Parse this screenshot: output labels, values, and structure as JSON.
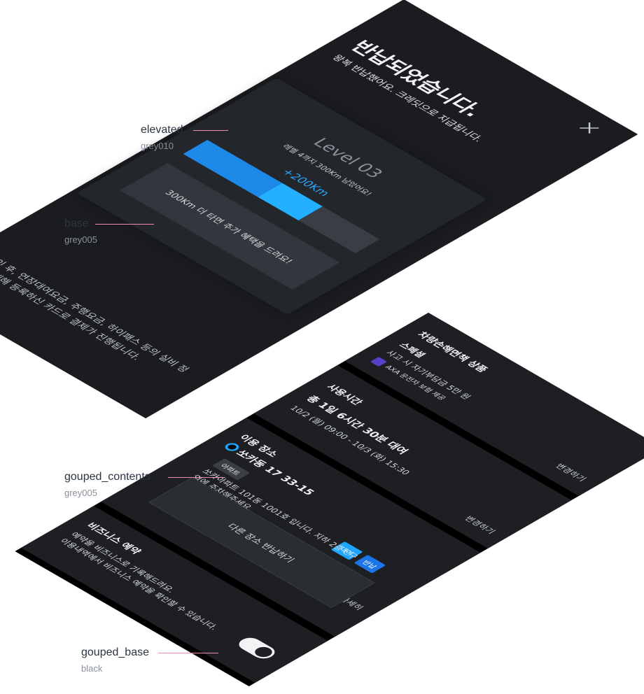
{
  "complete_screen": {
    "title": "반납되었습니다.",
    "subtitle": "왕복 반납했어요. 크레딧으로 지급됩니다.",
    "notice": "확인 후, 연장대여요금, 주행요금, 하이패스 등의 실비 정산에 대해 등록하신 카드로 결제가 진행됩니다."
  },
  "level_card": {
    "title": "Level 03",
    "subtitle": "레벨 4까지 300Km 남았어요!",
    "gain": "+200Km",
    "progress": 0.67,
    "button": "300Km 더 타면 추가 혜택을 드려요!"
  },
  "insurance": {
    "title": "차량손해면책 상품",
    "plan": "스페셜",
    "desc": "사고 시 자기부담금 5만 원",
    "badge": "AXA 운전자 보험 제공",
    "change": "변경하기"
  },
  "usage_time": {
    "title": "사용시간",
    "total": "총 1일 6시간 30분 대여",
    "range": "10/2 (월) 09:00 - 10/3 (화) 15:30",
    "change": "변경하기"
  },
  "place": {
    "title": "이용 장소",
    "name": "쏘카동 17 33-15",
    "chip": "아파트",
    "rent_chip": "대여",
    "return_chip": "반납",
    "desc": "쏘카아파트 101동 1001호 입니다. 지하 2층 C구역에 주차해주세요.",
    "detail": "자세히",
    "button": "다른 장소 반납하기"
  },
  "business": {
    "title": "비즈니스 예약",
    "desc_1": "예약을 비즈니스로 기록해드려요.",
    "desc_2": "이용내역에서 비즈니스 예약을 확인할 수 있습니다.",
    "toggle_on": true
  },
  "labels": {
    "elevated": {
      "name": "elevated",
      "token": "grey010"
    },
    "base": {
      "name": "base",
      "token": "grey005"
    },
    "grouped_contents": {
      "name": "gouped_contents",
      "token": "grey005"
    },
    "grouped_base": {
      "name": "gouped_base",
      "token": "black"
    }
  },
  "colors": {
    "base": "#1a1c1f",
    "elevated": "#23262b",
    "grouped_contents": "#1d1f23",
    "grouped_base": "#000000",
    "accent": "#1ea6ff",
    "label_line": "#f08aa8"
  }
}
